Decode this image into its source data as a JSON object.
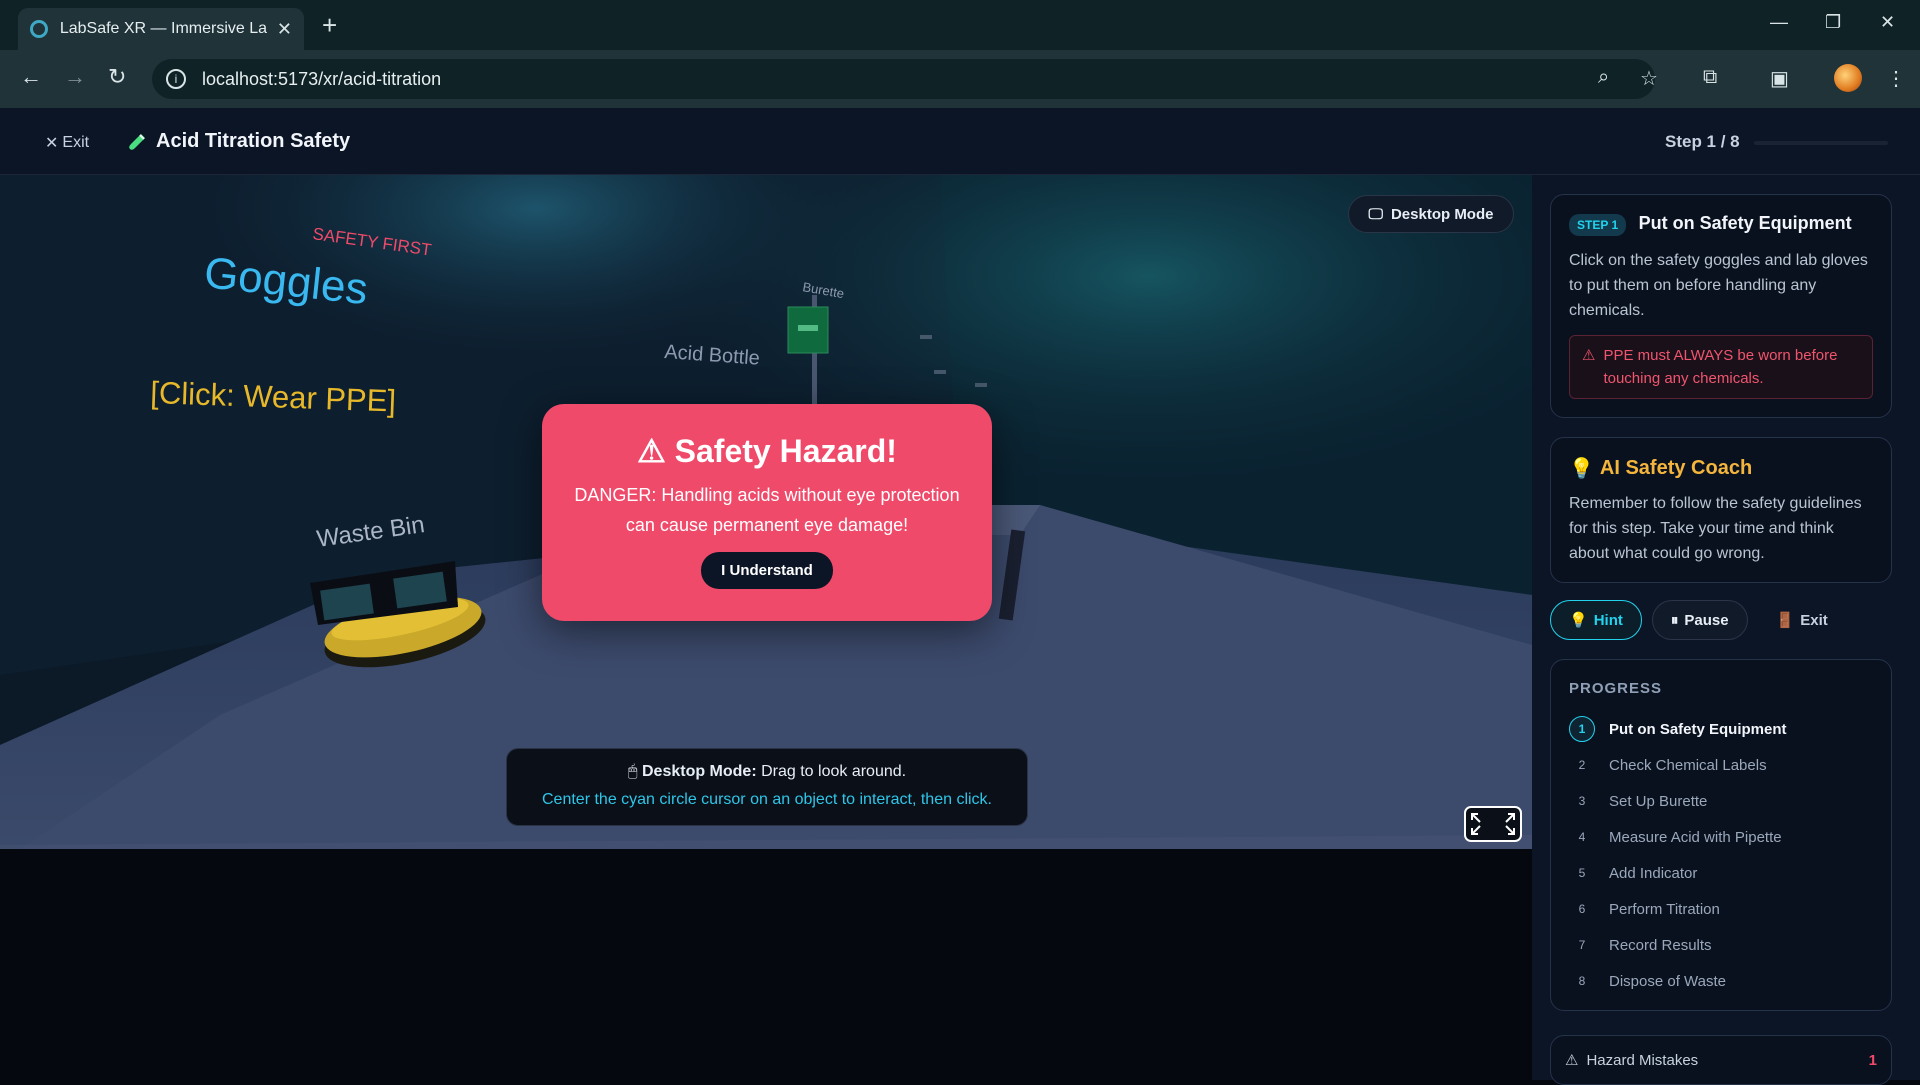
{
  "browser": {
    "tab_title": "LabSafe XR — Immersive Lab S…",
    "url": "localhost:5173/xr/acid-titration"
  },
  "app": {
    "exit_label": "Exit",
    "title": "Acid Titration Safety",
    "step_indicator": "Step 1 / 8",
    "step_progress": 0.0
  },
  "scene": {
    "labels": {
      "safety_first": "SAFETY FIRST",
      "goggles": "Goggles",
      "click_hint": "[Click: Wear PPE]",
      "acid_bottle": "Acid Bottle",
      "burette": "Burette",
      "waste_bin": "Waste Bin"
    },
    "desktop_mode_button": "Desktop Mode",
    "modal": {
      "title": "Safety Hazard!",
      "message": "DANGER: Handling acids without eye protection can cause permanent eye damage!",
      "button": "I Understand"
    },
    "hint": {
      "bold": "Desktop Mode:",
      "text": " Drag to look around.",
      "line2": "Center the cyan circle cursor on an object to interact, then click."
    }
  },
  "sidebar": {
    "step_card": {
      "pill": "STEP 1",
      "title": "Put on Safety Equipment",
      "description": "Click on the safety goggles and lab gloves to put them on before handling any chemicals.",
      "warning": "PPE must ALWAYS be worn before touching any chemicals."
    },
    "coach": {
      "title": "AI Safety Coach",
      "description": "Remember to follow the safety guidelines for this step. Take your time and think about what could go wrong."
    },
    "actions": {
      "hint": "Hint",
      "pause": "Pause",
      "exit": "Exit"
    },
    "progress": {
      "heading": "PROGRESS",
      "items": [
        {
          "n": "1",
          "label": "Put on Safety Equipment"
        },
        {
          "n": "2",
          "label": "Check Chemical Labels"
        },
        {
          "n": "3",
          "label": "Set Up Burette"
        },
        {
          "n": "4",
          "label": "Measure Acid with Pipette"
        },
        {
          "n": "5",
          "label": "Add Indicator"
        },
        {
          "n": "6",
          "label": "Perform Titration"
        },
        {
          "n": "7",
          "label": "Record Results"
        },
        {
          "n": "8",
          "label": "Dispose of Waste"
        }
      ]
    },
    "hazard": {
      "label": "Hazard Mistakes",
      "count": "1"
    }
  }
}
